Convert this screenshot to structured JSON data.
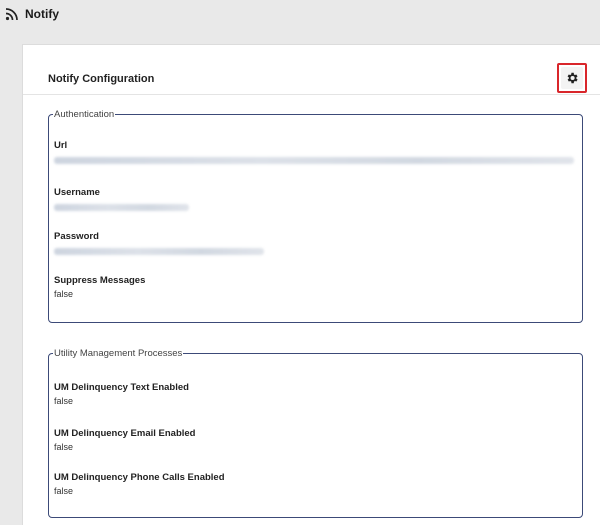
{
  "app": {
    "title": "Notify",
    "icon": "rss-feed-icon"
  },
  "panel": {
    "title": "Notify Configuration",
    "settings_icon": "gear-icon"
  },
  "authentication": {
    "legend": "Authentication",
    "fields": [
      {
        "label": "Url",
        "value": "",
        "obscured": true
      },
      {
        "label": "Username",
        "value": "",
        "obscured": true
      },
      {
        "label": "Password",
        "value": "",
        "obscured": true
      },
      {
        "label": "Suppress Messages",
        "value": "false",
        "obscured": false
      }
    ]
  },
  "utility_management": {
    "legend": "Utility Management Processes",
    "fields": [
      {
        "label": "UM Delinquency Text Enabled",
        "value": "false"
      },
      {
        "label": "UM Delinquency Email Enabled",
        "value": "false"
      },
      {
        "label": "UM Delinquency Phone Calls Enabled",
        "value": "false"
      }
    ]
  },
  "colors": {
    "highlight": "#d9262b",
    "group_border": "#3c4a78",
    "page_background": "#e9e9e9"
  }
}
